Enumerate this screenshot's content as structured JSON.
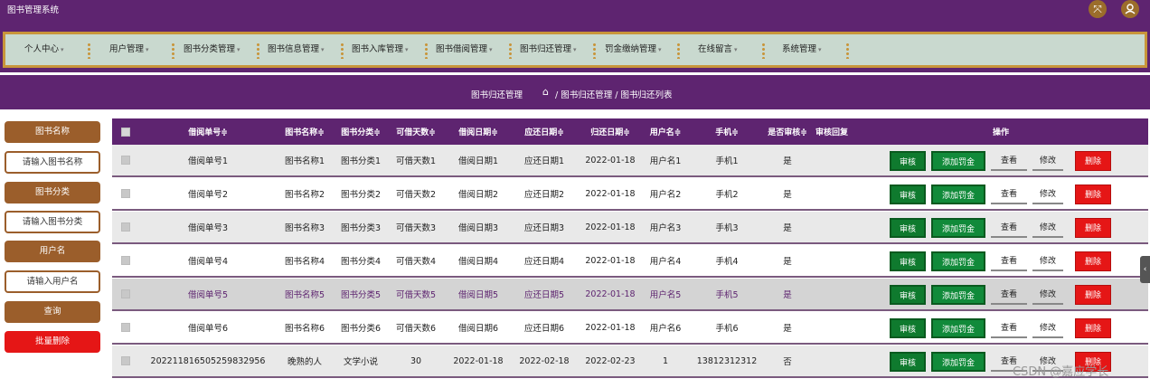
{
  "app": {
    "title": "图书管理系统"
  },
  "nav": {
    "items": [
      {
        "label": "个人中心"
      },
      {
        "label": "用户管理"
      },
      {
        "label": "图书分类管理"
      },
      {
        "label": "图书信息管理"
      },
      {
        "label": "图书入库管理"
      },
      {
        "label": "图书借阅管理"
      },
      {
        "label": "图书归还管理"
      },
      {
        "label": "罚金缴纳管理"
      },
      {
        "label": "在线留言"
      },
      {
        "label": "系统管理"
      }
    ],
    "caret": "▾"
  },
  "breadcrumb": {
    "title": "图书归还管理",
    "path": "/ 图书归还管理 / 图书归还列表"
  },
  "search": {
    "book_name_label": "图书名称",
    "book_name_placeholder": "请输入图书名称",
    "category_label": "图书分类",
    "category_placeholder": "请输入图书分类",
    "username_label": "用户名",
    "username_placeholder": "请输入用户名",
    "query_button": "查询",
    "batch_delete_button": "批量删除"
  },
  "table": {
    "headers": {
      "borrow_no": "借阅单号≑",
      "book_name": "图书名称≑",
      "category": "图书分类≑",
      "days": "可借天数≑",
      "borrow_date": "借阅日期≑",
      "due_date": "应还日期≑",
      "return_date": "归还日期≑",
      "username": "用户名≑",
      "phone": "手机≑",
      "audited": "是否审核≑",
      "reply": "审核回复",
      "ops": "操作"
    },
    "rows": [
      {
        "borrow_no": "借阅单号1",
        "book_name": "图书名称1",
        "category": "图书分类1",
        "days": "可借天数1",
        "borrow_date": "借阅日期1",
        "due_date": "应还日期1",
        "return_date": "2022-01-18",
        "username": "用户名1",
        "phone": "手机1",
        "audited": "是",
        "reply": ""
      },
      {
        "borrow_no": "借阅单号2",
        "book_name": "图书名称2",
        "category": "图书分类2",
        "days": "可借天数2",
        "borrow_date": "借阅日期2",
        "due_date": "应还日期2",
        "return_date": "2022-01-18",
        "username": "用户名2",
        "phone": "手机2",
        "audited": "是",
        "reply": ""
      },
      {
        "borrow_no": "借阅单号3",
        "book_name": "图书名称3",
        "category": "图书分类3",
        "days": "可借天数3",
        "borrow_date": "借阅日期3",
        "due_date": "应还日期3",
        "return_date": "2022-01-18",
        "username": "用户名3",
        "phone": "手机3",
        "audited": "是",
        "reply": ""
      },
      {
        "borrow_no": "借阅单号4",
        "book_name": "图书名称4",
        "category": "图书分类4",
        "days": "可借天数4",
        "borrow_date": "借阅日期4",
        "due_date": "应还日期4",
        "return_date": "2022-01-18",
        "username": "用户名4",
        "phone": "手机4",
        "audited": "是",
        "reply": ""
      },
      {
        "borrow_no": "借阅单号5",
        "book_name": "图书名称5",
        "category": "图书分类5",
        "days": "可借天数5",
        "borrow_date": "借阅日期5",
        "due_date": "应还日期5",
        "return_date": "2022-01-18",
        "username": "用户名5",
        "phone": "手机5",
        "audited": "是",
        "reply": ""
      },
      {
        "borrow_no": "借阅单号6",
        "book_name": "图书名称6",
        "category": "图书分类6",
        "days": "可借天数6",
        "borrow_date": "借阅日期6",
        "due_date": "应还日期6",
        "return_date": "2022-01-18",
        "username": "用户名6",
        "phone": "手机6",
        "audited": "是",
        "reply": ""
      },
      {
        "borrow_no": "202211816505259832956",
        "book_name": "晚熟的人",
        "category": "文学小说",
        "days": "30",
        "borrow_date": "2022-01-18",
        "due_date": "2022-02-18",
        "return_date": "2022-02-23",
        "username": "1",
        "phone": "13812312312",
        "audited": "否",
        "reply": ""
      }
    ],
    "actions": {
      "audit": "审核",
      "add_fine": "添加罚金",
      "view": "查看",
      "edit": "修改",
      "delete": "删除"
    }
  },
  "watermark": "CSDN @嘉应学长",
  "colors": {
    "primary": "#5e2470",
    "accent": "#9b5e2b",
    "nav_bg": "#c9d9cf",
    "danger": "#e51616",
    "success": "#0f7a2e"
  }
}
